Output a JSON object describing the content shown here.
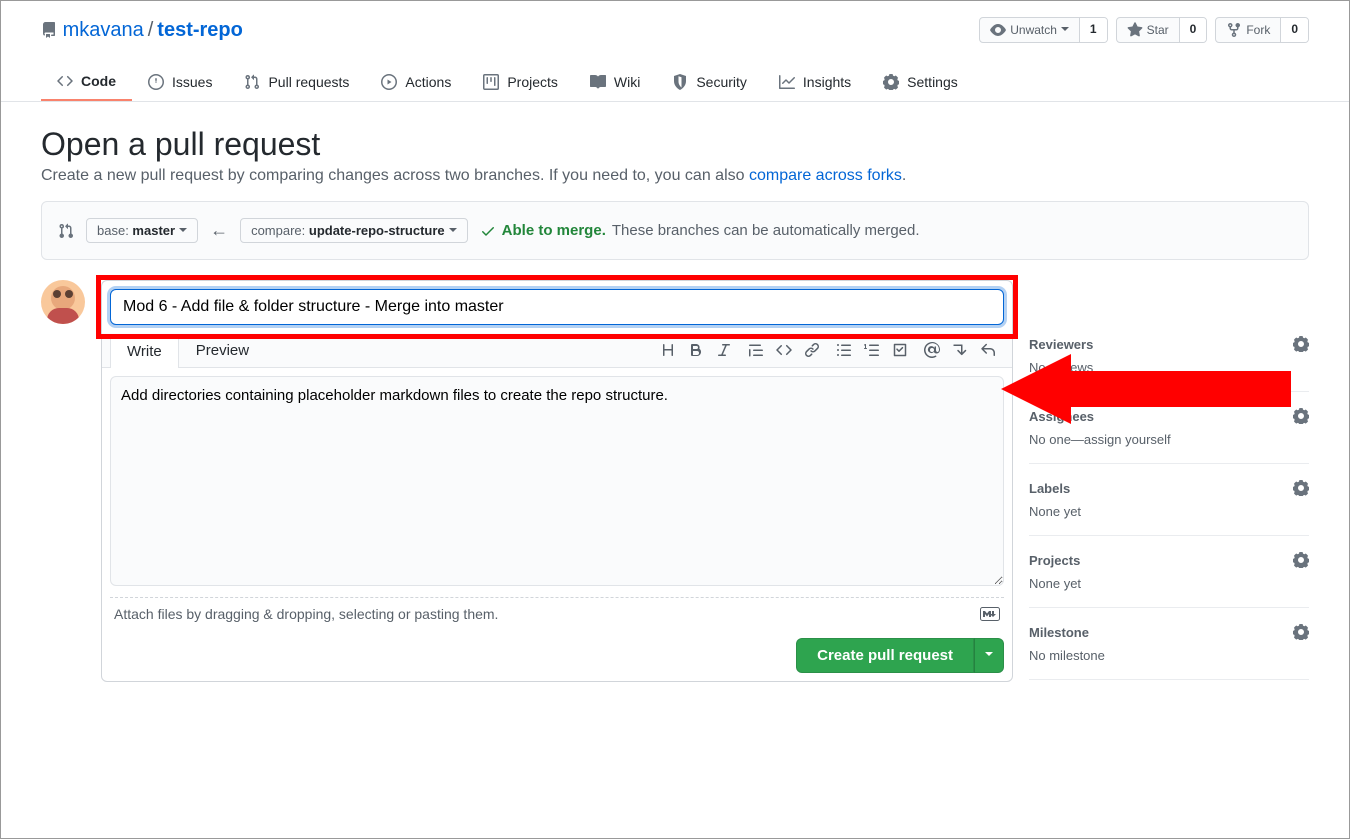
{
  "repo": {
    "owner": "mkavana",
    "name": "test-repo"
  },
  "actions": {
    "watch": {
      "label": "Unwatch",
      "count": "1"
    },
    "star": {
      "label": "Star",
      "count": "0"
    },
    "fork": {
      "label": "Fork",
      "count": "0"
    }
  },
  "tabs": {
    "code": "Code",
    "issues": "Issues",
    "pulls": "Pull requests",
    "actions": "Actions",
    "projects": "Projects",
    "wiki": "Wiki",
    "security": "Security",
    "insights": "Insights",
    "settings": "Settings"
  },
  "heading": "Open a pull request",
  "subtitle_a": "Create a new pull request by comparing changes across two branches. If you need to, you can also ",
  "subtitle_link": "compare across forks",
  "subtitle_b": ".",
  "compare": {
    "base_label": "base: ",
    "base_branch": "master",
    "compare_label": "compare: ",
    "compare_branch": "update-repo-structure",
    "able": "Able to merge.",
    "able_rest": "These branches can be automatically merged."
  },
  "form": {
    "title": "Mod 6 - Add file & folder structure - Merge into master",
    "write_tab": "Write",
    "preview_tab": "Preview",
    "body": "Add directories containing placeholder markdown files to create the repo structure.",
    "attach_hint": "Attach files by dragging & dropping, selecting or pasting them.",
    "submit": "Create pull request"
  },
  "sidebar": {
    "reviewers": {
      "title": "Reviewers",
      "value": "No reviews"
    },
    "assignees": {
      "title": "Assignees",
      "value": "No one—",
      "link": "assign yourself"
    },
    "labels": {
      "title": "Labels",
      "value": "None yet"
    },
    "projects": {
      "title": "Projects",
      "value": "None yet"
    },
    "milestone": {
      "title": "Milestone",
      "value": "No milestone"
    }
  }
}
